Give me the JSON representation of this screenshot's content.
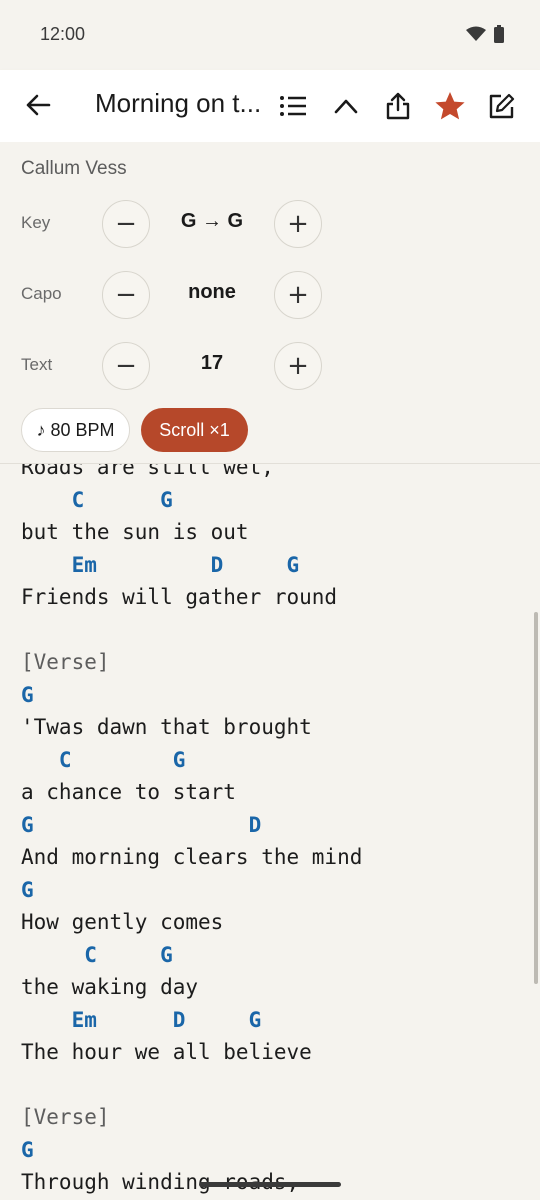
{
  "status": {
    "time": "12:00"
  },
  "app_bar": {
    "title": "Morning on t..."
  },
  "song": {
    "artist": "Callum Vess",
    "controls": [
      {
        "label": "Key",
        "value": "G → G"
      },
      {
        "label": "Capo",
        "value": "none"
      },
      {
        "label": "Text",
        "value": "17"
      }
    ],
    "tempo_label": "♪ 80 BPM",
    "scroll_label": "Scroll ×1"
  },
  "colors": {
    "accent": "#b6482a",
    "chord": "#1a66a8",
    "star": "#c4492c"
  },
  "lines": [
    {
      "type": "lyric",
      "text": "Roads are still wet,"
    },
    {
      "type": "chord",
      "text": "    C      G"
    },
    {
      "type": "lyric",
      "text": "but the sun is out"
    },
    {
      "type": "chord",
      "text": "    Em         D     G"
    },
    {
      "type": "lyric",
      "text": "Friends will gather round"
    },
    {
      "type": "blank",
      "text": ""
    },
    {
      "type": "section",
      "text": "[Verse]"
    },
    {
      "type": "chord",
      "text": "G"
    },
    {
      "type": "lyric",
      "text": "'Twas dawn that brought"
    },
    {
      "type": "chord",
      "text": "   C        G"
    },
    {
      "type": "lyric",
      "text": "a chance to start"
    },
    {
      "type": "chord",
      "text": "G                 D"
    },
    {
      "type": "lyric",
      "text": "And morning clears the mind"
    },
    {
      "type": "chord",
      "text": "G"
    },
    {
      "type": "lyric",
      "text": "How gently comes"
    },
    {
      "type": "chord",
      "text": "     C     G"
    },
    {
      "type": "lyric",
      "text": "the waking day"
    },
    {
      "type": "chord",
      "text": "    Em      D     G"
    },
    {
      "type": "lyric",
      "text": "The hour we all believe"
    },
    {
      "type": "blank",
      "text": ""
    },
    {
      "type": "section",
      "text": "[Verse]"
    },
    {
      "type": "chord",
      "text": "G"
    },
    {
      "type": "lyric",
      "text": "Through winding roads,"
    }
  ]
}
